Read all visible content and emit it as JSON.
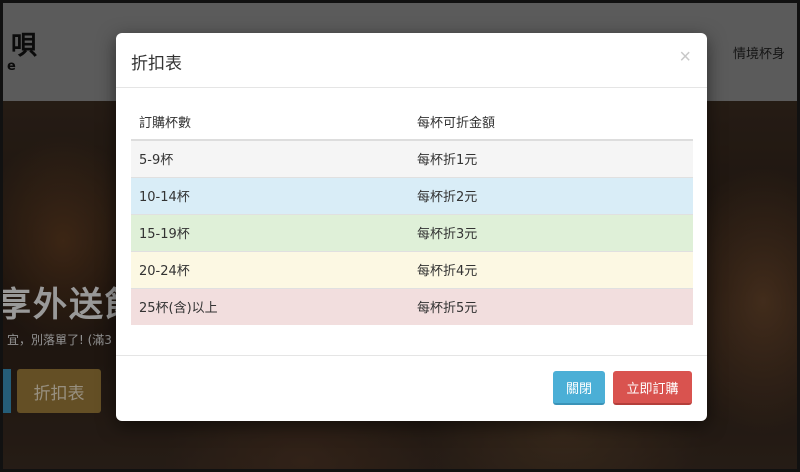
{
  "background": {
    "logo_char": "唄",
    "logo_sub": "e",
    "nav_item": "情境杯身",
    "hero_title": "享外送飲",
    "hero_subtitle": "宜，別落單了! (滿3",
    "hero_button": "折扣表"
  },
  "modal": {
    "title": "折扣表",
    "close_symbol": "×",
    "table": {
      "headers": [
        "訂購杯數",
        "每杯可折金額"
      ],
      "rows": [
        {
          "count": "5-9杯",
          "discount": "每杯折1元",
          "color": "#f5f5f5"
        },
        {
          "count": "10-14杯",
          "discount": "每杯折2元",
          "color": "#d9edf7"
        },
        {
          "count": "15-19杯",
          "discount": "每杯折3元",
          "color": "#dff0d8"
        },
        {
          "count": "20-24杯",
          "discount": "每杯折4元",
          "color": "#fcf8e3"
        },
        {
          "count": "25杯(含)以上",
          "discount": "每杯折5元",
          "color": "#f2dede"
        }
      ]
    },
    "footer": {
      "close_label": "關閉",
      "order_label": "立即訂購"
    }
  }
}
